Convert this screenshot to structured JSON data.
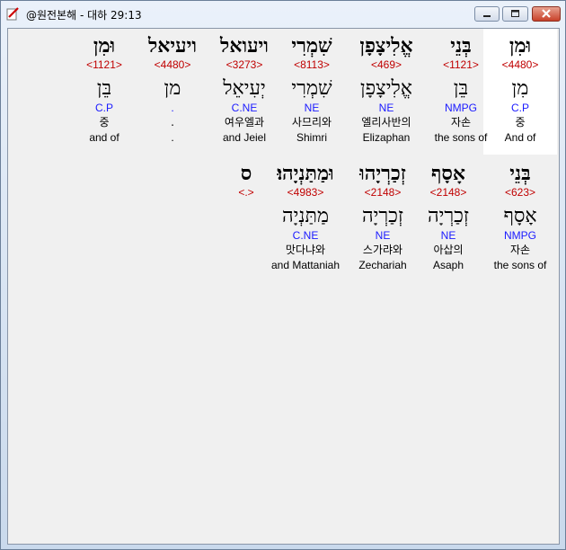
{
  "window": {
    "title": "@원전본해 - 대하 29:13"
  },
  "row1": [
    {
      "hebrew": "וּמִן",
      "strong": "<4480>",
      "lemma": "מִן",
      "morph": "C.P",
      "korean": "중",
      "english": "And of",
      "selected": true
    },
    {
      "hebrew": "בְּנֵי",
      "strong": "<1121>",
      "lemma": "בֵּן",
      "morph": "NMPG",
      "korean": "자손",
      "english": "the sons of"
    },
    {
      "hebrew": "אֱלִיצָפָן",
      "strong": "<469>",
      "lemma": "אֱלִיצָפָן",
      "morph": "NE",
      "korean": "엘리사반의",
      "english": "Elizaphan"
    },
    {
      "hebrew": "שִׁמְרִי",
      "strong": "<8113>",
      "lemma": "שִׁמְרִי",
      "morph": "NE",
      "korean": "사므리와",
      "english": "Shimri"
    },
    {
      "hebrew": "ויעואל",
      "strong": "<3273>",
      "lemma": "יְעִיאֵל",
      "morph": "C.NE",
      "korean": "여우엘과",
      "english": "and Jeiel"
    },
    {
      "hebrew": "ויעיאל",
      "strong": "<4480>",
      "lemma": "מן",
      "morph": ".",
      "korean": ".",
      "english": "."
    },
    {
      "hebrew": "וּמִן",
      "strong": "<1121>",
      "lemma": "בֵּן",
      "morph": "C.P",
      "korean": "중",
      "english": "and of"
    }
  ],
  "row2": [
    {
      "hebrew": "בְּנֵי",
      "strong": "<623>",
      "lemma": "אָסָף",
      "morph": "NMPG",
      "korean": "자손",
      "english": "the sons of"
    },
    {
      "hebrew": "אָסָף",
      "strong": "<2148>",
      "lemma": "זְכַרְיָה",
      "morph": "NE",
      "korean": "아삽의",
      "english": "Asaph"
    },
    {
      "hebrew": "זְכַרְיָהוּ",
      "strong": "<2148>",
      "lemma": "זְכַרְיָה",
      "morph": "NE",
      "korean": "스가랴와",
      "english": "Zechariah"
    },
    {
      "hebrew": "וּמַתַּנְיָהוּ׃",
      "strong": "<4983>",
      "lemma": "מַתַּנְיָה",
      "morph": "C.NE",
      "korean": "맛다냐와",
      "english": "and Mattaniah"
    },
    {
      "hebrew": "ס",
      "strong": "<.>"
    }
  ]
}
